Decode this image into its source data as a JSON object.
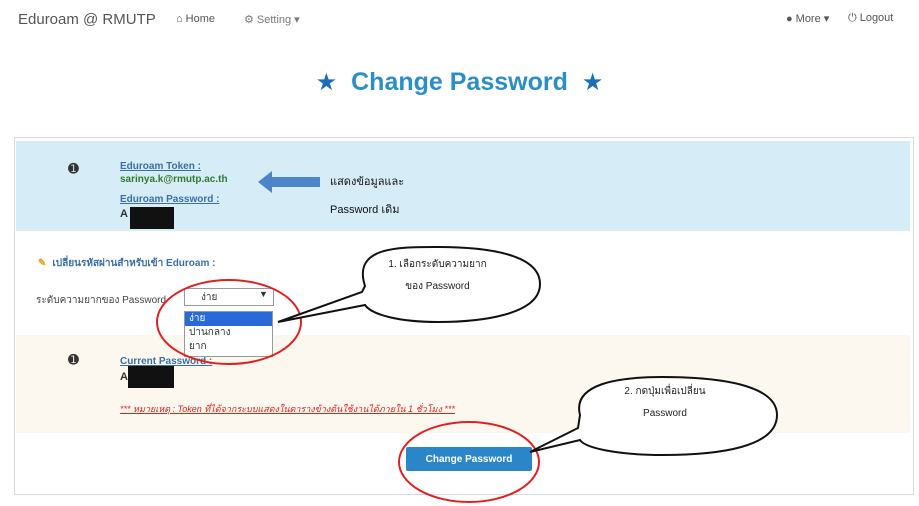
{
  "navbar": {
    "brand": "Eduroam @ RMUTP",
    "home": "Home",
    "setting": "Setting ▾",
    "more": "More ▾",
    "logout": "Logout"
  },
  "page": {
    "title": "Change Password"
  },
  "info": {
    "token_label": "Eduroam Token :",
    "token_value": "sarinya.k@rmutp.ac.th",
    "password_label": "Eduroam Password :",
    "password_value": "A",
    "note_line1": "แสดงข้อมูลและ",
    "note_line2": "Password เดิม"
  },
  "form": {
    "section_title": "เปลี่ยนรหัสผ่านสำหรับเข้า Eduroam :",
    "level_label": "ระดับความยากของ Password",
    "select_value": "ง่าย",
    "options": [
      "ง่าย",
      "ปานกลาง",
      "ยาก"
    ],
    "current_label": "Current Password :",
    "current_value": "A",
    "warning": "*** หมายเหตุ : Token ที่ได้จากระบบแสดงในตารางข้างต้นใช้งานได้ภายใน 1 ชั่วโมง ***",
    "submit_label": "Change Password"
  },
  "annotations": {
    "callout1_line1": "1. เลือกระดับความยาก",
    "callout1_line2": "ของ Password",
    "callout2_line1": "2. กดปุ่มเพื่อเปลี่ยน",
    "callout2_line2": "Password"
  },
  "colors": {
    "accent": "#2a8fc7",
    "info_bg": "#d6ecf7",
    "warn_bg": "#fdf8ef",
    "button": "#2a86c9",
    "highlight": "#e02020"
  }
}
